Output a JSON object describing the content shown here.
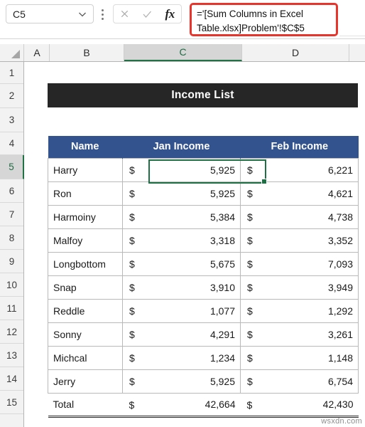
{
  "formula_bar": {
    "name_box_value": "C5",
    "name_box_placeholder": "Name Box",
    "dropdown_icon": "chevron-down-icon",
    "kebab_icon": "more-options-icon",
    "cancel_icon": "cancel-x-icon",
    "confirm_icon": "confirm-check-icon",
    "function_icon": "fx-insert-function-icon",
    "formula_value": "='[Sum Columns in Excel Table.xlsx]Problem'!$C$5",
    "formula_placeholder": "Enter formula",
    "highlight_color": "#e8342a"
  },
  "grid": {
    "select_all_icon": "select-all-corner-icon",
    "columns": [
      "A",
      "B",
      "C",
      "D"
    ],
    "selected_column": "C",
    "rows": [
      "1",
      "2",
      "3",
      "4",
      "5",
      "6",
      "7",
      "8",
      "9",
      "10",
      "11",
      "12",
      "13",
      "14",
      "15"
    ],
    "selected_row": "5",
    "selected_cell": "C5",
    "header_selection_color": "#217346",
    "selection_border_color": "#1e7145"
  },
  "sheet": {
    "title_banner": "Income List",
    "title_banner_bg": "#262626",
    "table_header_bg": "#33538e",
    "table": {
      "headers": [
        "Name",
        "Jan Income",
        "Feb Income"
      ],
      "currency_symbol": "$",
      "rows": [
        {
          "name": "Harry",
          "jan": "5,925",
          "feb": "6,221"
        },
        {
          "name": "Ron",
          "jan": "5,925",
          "feb": "4,621"
        },
        {
          "name": "Harmoiny",
          "jan": "5,384",
          "feb": "4,738"
        },
        {
          "name": "Malfoy",
          "jan": "3,318",
          "feb": "3,352"
        },
        {
          "name": "Longbottom",
          "jan": "5,675",
          "feb": "7,093"
        },
        {
          "name": "Snap",
          "jan": "3,910",
          "feb": "3,949"
        },
        {
          "name": "Reddle",
          "jan": "1,077",
          "feb": "1,292"
        },
        {
          "name": "Sonny",
          "jan": "4,291",
          "feb": "3,261"
        },
        {
          "name": "Michcal",
          "jan": "1,234",
          "feb": "1,148"
        },
        {
          "name": "Jerry",
          "jan": "5,925",
          "feb": "6,754"
        }
      ],
      "total": {
        "name": "Total",
        "jan": "42,664",
        "feb": "42,430"
      }
    }
  },
  "watermark": "wsxdn.com"
}
